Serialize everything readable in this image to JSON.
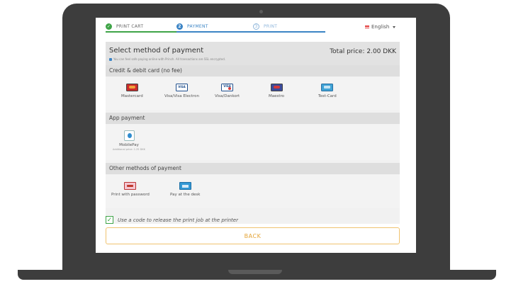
{
  "steps": [
    {
      "label": "PRINT CART",
      "icon": "check-icon",
      "marker": "✓"
    },
    {
      "label": "PAYMENT",
      "marker": "2"
    },
    {
      "label": "PRINT",
      "marker": "3"
    }
  ],
  "language": {
    "label": "English"
  },
  "payment": {
    "title": "Select method of payment",
    "secure_note": "You can feel safe paying online with Princh. All transactions are SSL encrypted.",
    "total": "Total price: 2.00 DKK",
    "cards_header": "Credit & debit card (no fee)",
    "cards": [
      {
        "label": "Mastercard",
        "icon": "mastercard-icon"
      },
      {
        "label": "Visa/Visa Electron",
        "icon": "visa-icon"
      },
      {
        "label": "Visa/Dankort",
        "icon": "visa-dankort-icon"
      },
      {
        "label": "Maestro",
        "icon": "maestro-icon"
      },
      {
        "label": "Test-Card",
        "icon": "test-card-icon"
      }
    ],
    "app_header": "App payment",
    "app": {
      "label": "MobilePay",
      "note": "Additional price: 1.25 DKK",
      "icon": "mobilepay-icon"
    },
    "other_header": "Other methods of payment",
    "other": [
      {
        "label": "Print with password",
        "icon": "password-icon"
      },
      {
        "label": "Pay at the desk",
        "icon": "desk-icon"
      }
    ]
  },
  "release_code": {
    "label": "Use a code to release the print job at the printer",
    "checked": true
  },
  "back_label": "BACK",
  "colors": {
    "accent_green": "#3fa447",
    "accent_blue": "#3b84c5",
    "back_orange": "#e4a437"
  }
}
